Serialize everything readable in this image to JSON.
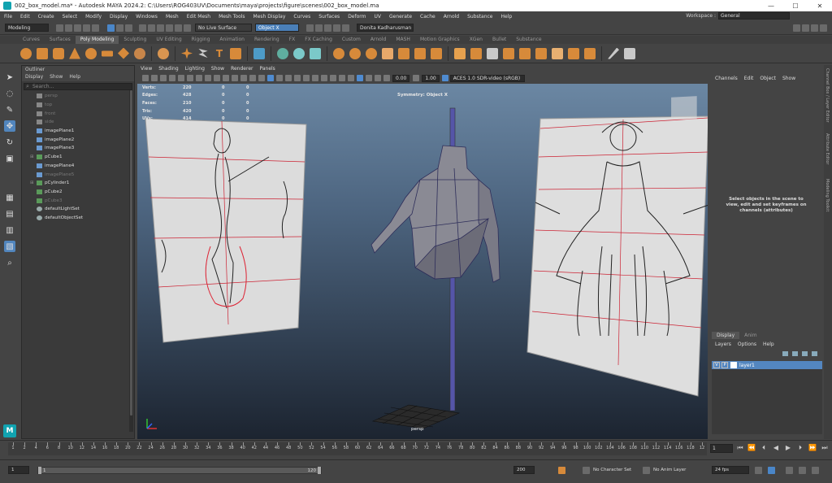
{
  "window": {
    "title": "002_box_model.ma* - Autodesk MAYA 2024.2: C:\\Users\\ROG403UV\\Documents\\maya\\projects\\figure\\scenes\\002_box_model.ma",
    "min": "—",
    "max": "☐",
    "close": "✕"
  },
  "menubar": {
    "items": [
      "File",
      "Edit",
      "Create",
      "Select",
      "Modify",
      "Display",
      "Windows",
      "Mesh",
      "Edit Mesh",
      "Mesh Tools",
      "Mesh Display",
      "Curves",
      "Surfaces",
      "Deform",
      "UV",
      "Generate",
      "Cache",
      "Arnold",
      "Substance",
      "Help"
    ],
    "workspace_label": "Workspace :",
    "workspace_value": "General"
  },
  "statusline": {
    "mode": "Modeling",
    "live_surface": "No Live Surface",
    "symmetry": "Object X",
    "user": "Donita Kadharusman"
  },
  "shelf": {
    "tabs": [
      "Curves",
      "Surfaces",
      "Poly Modeling",
      "Sculpting",
      "UV Editing",
      "Rigging",
      "Animation",
      "Rendering",
      "FX",
      "FX Caching",
      "Custom",
      "Arnold",
      "MASH",
      "Motion Graphics",
      "XGen",
      "Bullet",
      "Substance"
    ],
    "active_tab": "Poly Modeling"
  },
  "outliner": {
    "title": "Outliner",
    "menu": [
      "Display",
      "Show",
      "Help"
    ],
    "search_placeholder": "Search...",
    "items": [
      {
        "label": "persp",
        "dim": true,
        "icon": "cam"
      },
      {
        "label": "top",
        "dim": true,
        "icon": "cam"
      },
      {
        "label": "front",
        "dim": true,
        "icon": "cam"
      },
      {
        "label": "side",
        "dim": true,
        "icon": "cam"
      },
      {
        "label": "imagePlane1",
        "dim": false,
        "icon": "img"
      },
      {
        "label": "imagePlane2",
        "dim": false,
        "icon": "img"
      },
      {
        "label": "imagePlane3",
        "dim": false,
        "icon": "img"
      },
      {
        "label": "pCube1",
        "dim": false,
        "icon": "mesh",
        "expand": true
      },
      {
        "label": "imagePlane4",
        "dim": false,
        "icon": "img"
      },
      {
        "label": "imagePlane5",
        "dim": true,
        "icon": "img"
      },
      {
        "label": "pCylinder1",
        "dim": false,
        "icon": "mesh",
        "expand": true
      },
      {
        "label": "pCube2",
        "dim": false,
        "icon": "mesh"
      },
      {
        "label": "pCube3",
        "dim": true,
        "icon": "mesh"
      },
      {
        "label": "defaultLightSet",
        "dim": false,
        "icon": "set"
      },
      {
        "label": "defaultObjectSet",
        "dim": false,
        "icon": "set"
      }
    ]
  },
  "viewport": {
    "menu": [
      "View",
      "Shading",
      "Lighting",
      "Show",
      "Renderer",
      "Panels"
    ],
    "exposure": "0.00",
    "gamma": "1.00",
    "color_space": "ACES 1.0 SDR-video (sRGB)",
    "hud": [
      {
        "label": "Verts:",
        "v1": "220",
        "v2": "0",
        "v3": "0"
      },
      {
        "label": "Edges:",
        "v1": "428",
        "v2": "0",
        "v3": "0"
      },
      {
        "label": "Faces:",
        "v1": "210",
        "v2": "0",
        "v3": "0"
      },
      {
        "label": "Tris:",
        "v1": "420",
        "v2": "0",
        "v3": "0"
      },
      {
        "label": "UVs:",
        "v1": "414",
        "v2": "0",
        "v3": "0"
      }
    ],
    "symmetry": "Symmetry: Object X",
    "camera": "persp"
  },
  "channelbox": {
    "menu": [
      "Channels",
      "Edit",
      "Object",
      "Show"
    ],
    "message": "Select objects in the scene to view, edit and set keyframes on channels (attributes)",
    "layer_tabs": [
      "Display",
      "Anim"
    ],
    "layer_menu": [
      "Layers",
      "Options",
      "Help"
    ],
    "layer": {
      "v": "V",
      "p": "P",
      "name": "layer1"
    },
    "side_tabs": [
      "Channel Box / Layer Editor",
      "Attribute Editor",
      "Modeling Toolkit"
    ]
  },
  "timeline": {
    "ticks": [
      "1",
      "2",
      "4",
      "6",
      "8",
      "10",
      "12",
      "14",
      "16",
      "18",
      "20",
      "22",
      "24",
      "26",
      "28",
      "30",
      "32",
      "34",
      "36",
      "38",
      "40",
      "42",
      "44",
      "46",
      "48",
      "50",
      "52",
      "54",
      "56",
      "58",
      "60",
      "62",
      "64",
      "66",
      "68",
      "70",
      "72",
      "74",
      "76",
      "78",
      "80",
      "82",
      "84",
      "86",
      "88",
      "90",
      "92",
      "94",
      "96",
      "98",
      "100",
      "102",
      "104",
      "106",
      "108",
      "110",
      "112",
      "114",
      "116",
      "118",
      "12"
    ],
    "current_frame": "1"
  },
  "range": {
    "start": "1",
    "inner_start": "1",
    "inner_end": "120",
    "end": "200",
    "character_set": "No Character Set",
    "anim_layer": "No Anim Layer",
    "fps": "24 fps"
  },
  "colors": {
    "accent": "#5386c0",
    "maya_teal": "#11a3b0",
    "selection": "#d78a3a"
  }
}
